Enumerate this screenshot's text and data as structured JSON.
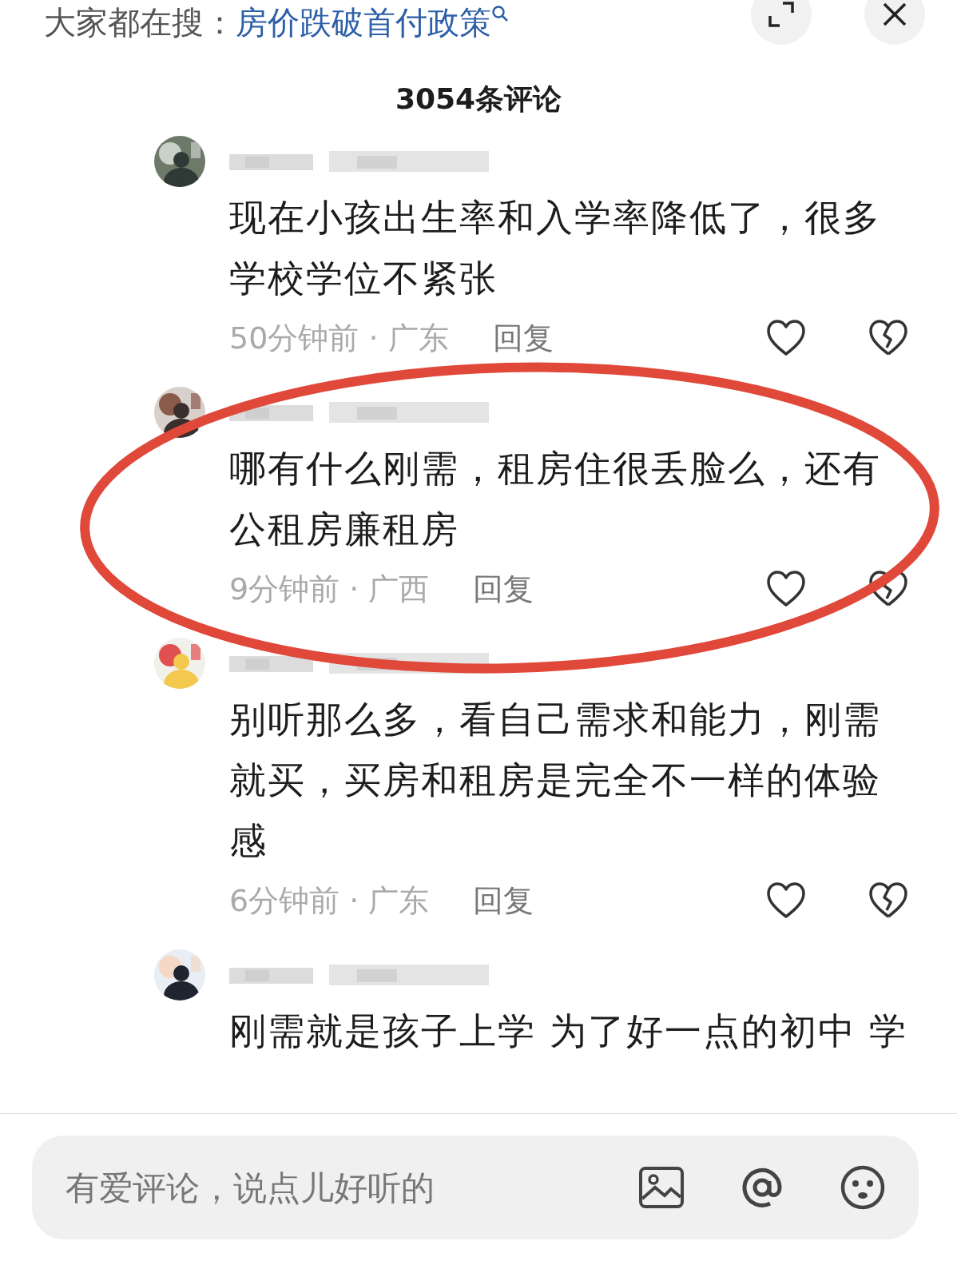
{
  "search_hint": {
    "label": "大家都在搜：",
    "query": "房价跌破首付政策"
  },
  "title": "3054条评论",
  "comments": [
    {
      "text": "现在小孩出生率和入学率降低了，很多学校学位不紧张",
      "meta": "50分钟前 · 广东",
      "reply": "回复"
    },
    {
      "text": "哪有什么刚需，租房住很丢脸么，还有公租房廉租房",
      "meta": "9分钟前 · 广西",
      "reply": "回复"
    },
    {
      "text": "别听那么多，看自己需求和能力，刚需就买，买房和租房是完全不一样的体验感",
      "meta": "6分钟前 · 广东",
      "reply": "回复"
    },
    {
      "text": "刚需就是孩子上学 为了好一点的初中 学"
    }
  ],
  "input": {
    "placeholder": "有爱评论，说点儿好听的"
  }
}
